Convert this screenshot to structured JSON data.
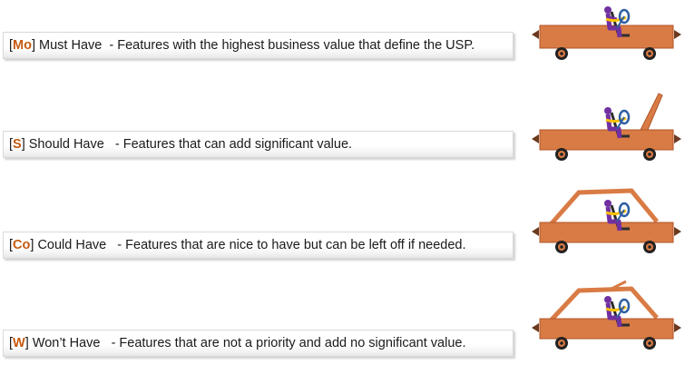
{
  "colors": {
    "code_accent": "#c55a11",
    "car_body": "#d97b44",
    "car_outline": "#b0562a",
    "wheel": "#222222",
    "driver": "#7030a0",
    "steering": "#2e5fa3",
    "seat": "#2e2e2e",
    "belt": "#ffc000"
  },
  "items": [
    {
      "code": "Mo",
      "name": "Must Have",
      "description": "- Features with the highest business value that define the USP.",
      "car_icon": "car-no-roof-icon"
    },
    {
      "code": "S",
      "name": "Should Have",
      "description": "- Features that can add significant value.",
      "car_icon": "car-open-hood-icon"
    },
    {
      "code": "Co",
      "name": "Could Have",
      "description": "- Features that are nice to have but can be left off if needed.",
      "car_icon": "car-full-roof-icon"
    },
    {
      "code": "W",
      "name": "Won’t Have",
      "description": "- Features that are not a priority and add no significant value.",
      "car_icon": "car-antenna-roof-icon"
    }
  ]
}
